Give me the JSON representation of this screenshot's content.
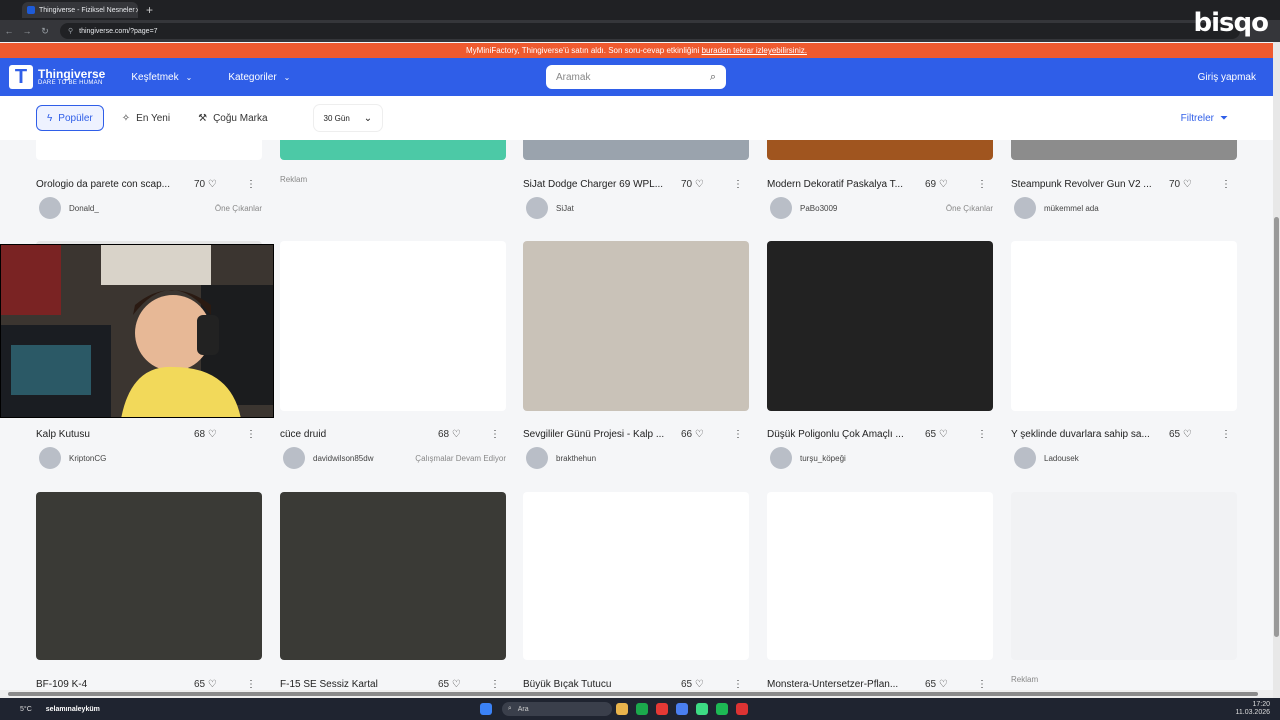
{
  "browser": {
    "tab_title": "Thingiverse - Fiziksel Nesneler",
    "url": "thingiverse.com/?page=7"
  },
  "overlay": {
    "watermark": "bisqo"
  },
  "banner": {
    "text": "MyMiniFactory, Thingiverse'ü satın aldı. Son soru-cevap etkinliğini ",
    "link": "buradan tekrar izleyebilirsiniz."
  },
  "header": {
    "logo_name": "Thingiverse",
    "logo_tag": "DARE TO BE HUMAN",
    "menu_explore": "Keşfetmek",
    "menu_categories": "Kategoriler",
    "search_placeholder": "Aramak",
    "login": "Giriş yapmak"
  },
  "filters": {
    "popular": "Popüler",
    "newest": "En Yeni",
    "most_remixed": "Çoğu Marka",
    "days": "30 Gün",
    "filters_label": "Filtreler"
  },
  "rows": [
    {
      "cards": [
        {
          "title": "Orologio da parete con scap...",
          "likes": "70",
          "user": "Donald_",
          "badge": "Öne Çıkanlar",
          "img": "#ffffff"
        },
        {
          "ad": "Reklam",
          "img": "#4cc9a6"
        },
        {
          "title": "SiJat Dodge Charger 69 WPL...",
          "likes": "70",
          "user": "SiJat",
          "badge": "",
          "img": "#9aa3ad"
        },
        {
          "title": "Modern Dekoratif Paskalya T...",
          "likes": "69",
          "user": "PaBo3009",
          "badge": "Öne Çıkanlar",
          "img": "#a0551f"
        },
        {
          "title": "Steampunk Revolver Gun V2 ...",
          "likes": "70",
          "user": "mükemmel ada",
          "badge": "",
          "img": "#8c8c8c"
        }
      ]
    },
    {
      "cards": [
        {
          "title": "Kalp Kutusu",
          "likes": "68",
          "user": "KriptonCG",
          "badge": "",
          "img": "#e6e6e6"
        },
        {
          "title": "cüce druid",
          "likes": "68",
          "user": "davidwilson85dw",
          "badge": "Çalışmalar Devam Ediyor",
          "img": "#ffffff"
        },
        {
          "title": "Sevgililer Günü Projesi - Kalp ...",
          "likes": "66",
          "user": "brakthehun",
          "badge": "",
          "img": "#c9c2b8"
        },
        {
          "title": "Düşük Poligonlu Çok Amaçlı ...",
          "likes": "65",
          "user": "turşu_köpeği",
          "badge": "",
          "img": "#222"
        },
        {
          "title": "Y şeklinde duvarlara sahip sa...",
          "likes": "65",
          "user": "Ladousek",
          "badge": "",
          "img": "#ffffff"
        }
      ]
    },
    {
      "cards": [
        {
          "title": "BF-109 K-4",
          "likes": "65",
          "img": "#3a3a36"
        },
        {
          "title": "F-15 SE Sessiz Kartal",
          "likes": "65",
          "img": "#3a3a36"
        },
        {
          "title": "Büyük Bıçak Tutucu",
          "likes": "65",
          "img": "#ffffff"
        },
        {
          "title": "Monstera-Untersetzer-Pflan...",
          "likes": "65",
          "img": "#ffffff"
        },
        {
          "ad": "Reklam",
          "img": "#f1f2f4"
        }
      ]
    }
  ],
  "taskbar": {
    "weather": "5°C",
    "chat": "selamınaleyküm",
    "search": "Ara",
    "time": "17:20",
    "date": "11.03.2026"
  }
}
